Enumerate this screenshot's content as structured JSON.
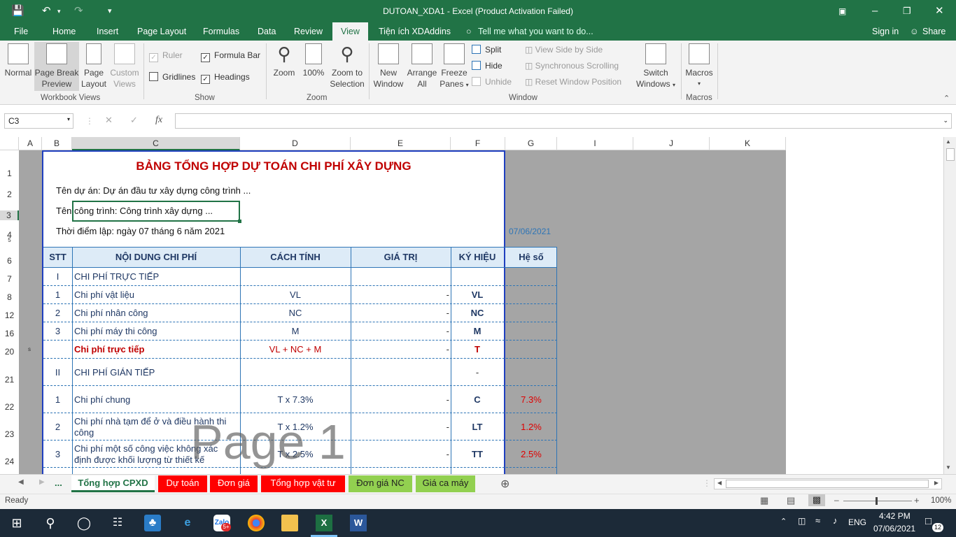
{
  "window": {
    "title": "DUTOAN_XDA1  -  Excel (Product Activation Failed)"
  },
  "menu": {
    "tabs": [
      "File",
      "Home",
      "Insert",
      "Page Layout",
      "Formulas",
      "Data",
      "Review",
      "View",
      "Tiện ích XDAddins"
    ],
    "tell_me": "Tell me what you want to do...",
    "sign_in": "Sign in",
    "share": "Share"
  },
  "ribbon": {
    "workbook_views": {
      "label": "Workbook Views",
      "normal": "Normal",
      "page_break": "Page Break",
      "page_break2": "Preview",
      "page_layout": "Page",
      "page_layout2": "Layout",
      "custom": "Custom",
      "custom2": "Views"
    },
    "show": {
      "label": "Show",
      "ruler": "Ruler",
      "formula_bar": "Formula Bar",
      "gridlines": "Gridlines",
      "headings": "Headings"
    },
    "zoom": {
      "label": "Zoom",
      "zoom": "Zoom",
      "z100": "100%",
      "zoom_sel": "Zoom to",
      "zoom_sel2": "Selection"
    },
    "window": {
      "label": "Window",
      "new_window": "New",
      "new_window2": "Window",
      "arrange": "Arrange",
      "arrange2": "All",
      "freeze": "Freeze",
      "freeze2": "Panes",
      "split": "Split",
      "hide": "Hide",
      "unhide": "Unhide",
      "side": "View Side by Side",
      "sync": "Synchronous Scrolling",
      "reset": "Reset Window Position",
      "switch": "Switch",
      "switch2": "Windows"
    },
    "macros": {
      "label": "Macros",
      "macros": "Macros"
    }
  },
  "formula_bar": {
    "name_box": "C3",
    "fx": "fx",
    "content": ""
  },
  "columns": [
    "A",
    "B",
    "C",
    "D",
    "E",
    "F",
    "G",
    "I",
    "J",
    "K"
  ],
  "rows": [
    "1",
    "2",
    "3",
    "4",
    "5",
    "6",
    "7",
    "8",
    "12",
    "16",
    "20",
    "21",
    "22",
    "23",
    "24"
  ],
  "sheet": {
    "title": "BẢNG TỔNG HỢP DỰ TOÁN CHI PHÍ XÂY DỰNG",
    "project": "Tên dự án: Dự án đầu tư xây dựng công trình ...",
    "work": "Tên công trình: Công trình xây dựng ...",
    "time": "Thời điểm lập: ngày 07 tháng 6 năm 2021",
    "date": "07/06/2021",
    "row20_marker": "s",
    "headers": {
      "stt": "STT",
      "content": "NỘI DUNG CHI PHÍ",
      "calc": "CÁCH TÍNH",
      "value": "GIÁ TRỊ",
      "symbol": "KÝ HIỆU",
      "coef": "Hệ số"
    },
    "rows": [
      {
        "stt": "I",
        "content": "CHI PHÍ TRỰC TIẾP",
        "calc": "",
        "value": "",
        "symbol": "",
        "coef": ""
      },
      {
        "stt": "1",
        "content": "Chi phí vật liệu",
        "calc": "VL",
        "value": "-",
        "symbol": "VL",
        "coef": ""
      },
      {
        "stt": "2",
        "content": "Chi phí nhân công",
        "calc": "NC",
        "value": "-",
        "symbol": "NC",
        "coef": ""
      },
      {
        "stt": "3",
        "content": "Chi phí máy thi công",
        "calc": "M",
        "value": "-",
        "symbol": "M",
        "coef": ""
      },
      {
        "stt": "",
        "content": "Chi phí trực tiếp",
        "calc": "VL + NC + M",
        "value": "-",
        "symbol": "T",
        "coef": ""
      },
      {
        "stt": "II",
        "content": "CHI PHÍ GIÁN TIẾP",
        "calc": "",
        "value": "",
        "symbol": "-",
        "coef": ""
      },
      {
        "stt": "1",
        "content": "Chi phí chung",
        "calc": "T x 7.3%",
        "value": "-",
        "symbol": "C",
        "coef": "7.3%"
      },
      {
        "stt": "2",
        "content": "Chi phí nhà tạm để ở và điều hành thi",
        "content2": "công",
        "calc": "T x 1.2%",
        "value": "-",
        "symbol": "LT",
        "coef": "1.2%"
      },
      {
        "stt": "3",
        "content": "Chi phí một số công việc không xác",
        "content2": "định được khối lượng từ thiết kế",
        "calc": "T x 2.5%",
        "value": "-",
        "symbol": "TT",
        "coef": "2.5%"
      }
    ],
    "watermark": "Page 1"
  },
  "sheet_tabs": {
    "more": "...",
    "tabs": [
      "Tổng hợp CPXD",
      "Dự toán",
      "Đơn giá",
      "Tổng hợp vật tư",
      "Đơn giá NC",
      "Giá ca máy"
    ]
  },
  "status": {
    "ready": "Ready",
    "zoom": "100%"
  },
  "taskbar": {
    "lang": "ENG",
    "time": "4:42 PM",
    "date": "07/06/2021",
    "badge": "12",
    "zalo_badge": "5+"
  },
  "colors": {
    "excel_green": "#217346",
    "header_fill": "#ddebf7",
    "red": "#c00000",
    "blue_text": "#1f3864"
  }
}
